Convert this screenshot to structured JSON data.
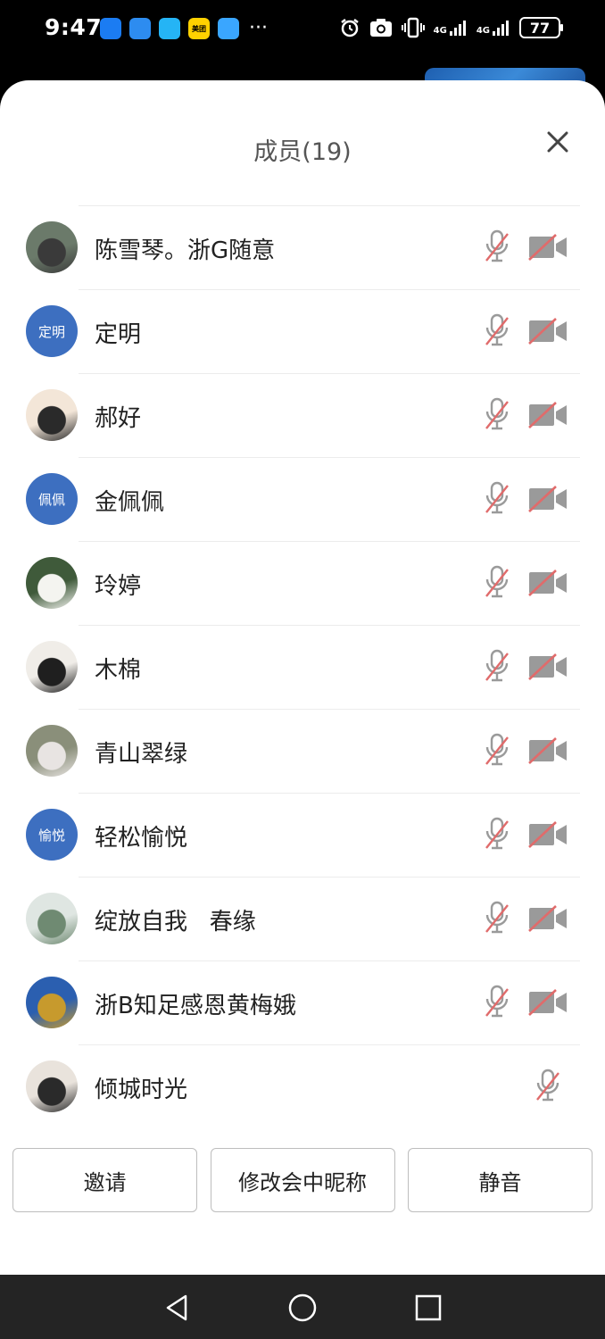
{
  "status_bar": {
    "time": "9:47",
    "battery": "77",
    "network_1": "4G",
    "network_2": "4G",
    "app_icons": [
      {
        "name": "blue-app-icon",
        "color": "#1b7cf2",
        "label": ""
      },
      {
        "name": "chat-app-icon",
        "color": "#2d8cf0",
        "label": ""
      },
      {
        "name": "message-app-icon",
        "color": "#25b4f5",
        "label": ""
      },
      {
        "name": "meituan-app-icon",
        "color": "#ffd100",
        "label": "美团"
      },
      {
        "name": "browser-app-icon",
        "color": "#3aa6ff",
        "label": ""
      }
    ],
    "more": "···"
  },
  "sheet": {
    "title": "成员(19)"
  },
  "members": [
    {
      "name": "陈雪琴。浙G随意",
      "avatar_text": "",
      "avatar_colors": [
        "#6b7a6a",
        "#3a3a3a"
      ],
      "mic_muted": true,
      "camera_off": true
    },
    {
      "name": "定明",
      "avatar_text": "定明",
      "mic_muted": true,
      "camera_off": true
    },
    {
      "name": "郝好",
      "avatar_text": "",
      "avatar_colors": [
        "#f3e6d8",
        "#2a2a2a"
      ],
      "mic_muted": true,
      "camera_off": true
    },
    {
      "name": "金佩佩",
      "avatar_text": "佩佩",
      "mic_muted": true,
      "camera_off": true
    },
    {
      "name": "玲婷",
      "avatar_text": "",
      "avatar_colors": [
        "#3f5a3a",
        "#f4f4f0"
      ],
      "mic_muted": true,
      "camera_off": true
    },
    {
      "name": "木棉",
      "avatar_text": "",
      "avatar_colors": [
        "#f0ede8",
        "#1f1f1f"
      ],
      "mic_muted": true,
      "camera_off": true
    },
    {
      "name": "青山翠绿",
      "avatar_text": "",
      "avatar_colors": [
        "#8a8f7a",
        "#e8e4e2"
      ],
      "mic_muted": true,
      "camera_off": true
    },
    {
      "name": "轻松愉悦",
      "avatar_text": "愉悦",
      "mic_muted": true,
      "camera_off": true
    },
    {
      "name": "绽放自我   春缘",
      "avatar_text": "",
      "avatar_colors": [
        "#dfe6e2",
        "#6f8a72"
      ],
      "mic_muted": true,
      "camera_off": true
    },
    {
      "name": "浙B知足感恩黄梅娥",
      "avatar_text": "",
      "avatar_colors": [
        "#2b5fb0",
        "#c79a2d"
      ],
      "mic_muted": true,
      "camera_off": true
    },
    {
      "name": "倾城时光",
      "avatar_text": "",
      "avatar_colors": [
        "#e9e3dc",
        "#2a2a2a"
      ],
      "mic_muted": true,
      "camera_off": false
    }
  ],
  "actions": {
    "invite": "邀请",
    "rename": "修改会中昵称",
    "mute": "静音"
  },
  "colors": {
    "accent_avatar": "#3d6fc0",
    "muted_icon_gray": "#9a9a9a",
    "muted_slash_red": "#e06b6b"
  }
}
